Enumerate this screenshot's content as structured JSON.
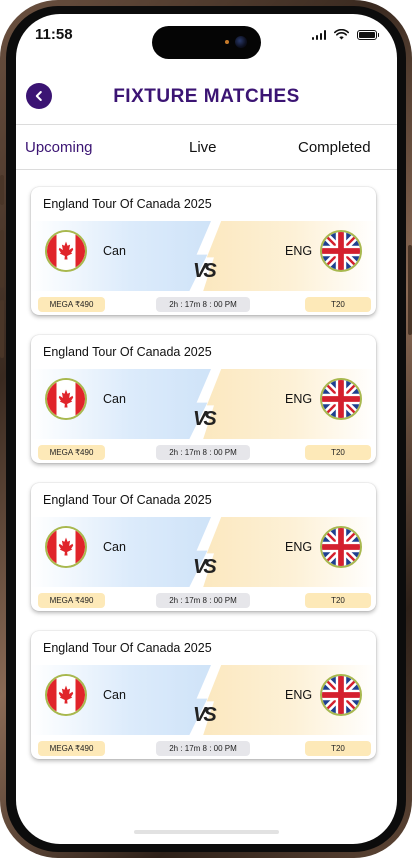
{
  "status_bar": {
    "time": "11:58"
  },
  "header": {
    "title": "FIXTURE MATCHES"
  },
  "tabs": [
    {
      "label": "Upcoming",
      "active": true
    },
    {
      "label": "Live",
      "active": false
    },
    {
      "label": "Completed",
      "active": false
    }
  ],
  "vs_label": "VS",
  "matches": [
    {
      "title": "England  Tour Of Canada 2025",
      "team_left": "Can",
      "team_right": "ENG",
      "prize": "MEGA  ₹490",
      "time": "2h : 17m  8 : 00 PM",
      "format": "T20"
    },
    {
      "title": "England  Tour Of Canada 2025",
      "team_left": "Can",
      "team_right": "ENG",
      "prize": "MEGA  ₹490",
      "time": "2h : 17m  8 : 00 PM",
      "format": "T20"
    },
    {
      "title": "England  Tour Of Canada 2025",
      "team_left": "Can",
      "team_right": "ENG",
      "prize": "MEGA  ₹490",
      "time": "2h : 17m  8 : 00 PM",
      "format": "T20"
    },
    {
      "title": "England  Tour Of Canada 2025",
      "team_left": "Can",
      "team_right": "ENG",
      "prize": "MEGA  ₹490",
      "time": "2h : 17m  8 : 00 PM",
      "format": "T20"
    }
  ],
  "colors": {
    "accent": "#3b1473",
    "pill_yellow": "#fde9b8",
    "pill_grey": "#e6e6ea"
  },
  "icons": {
    "back": "chevron-left-icon",
    "left_flag": "canada-flag-icon",
    "right_flag": "uk-flag-icon"
  }
}
